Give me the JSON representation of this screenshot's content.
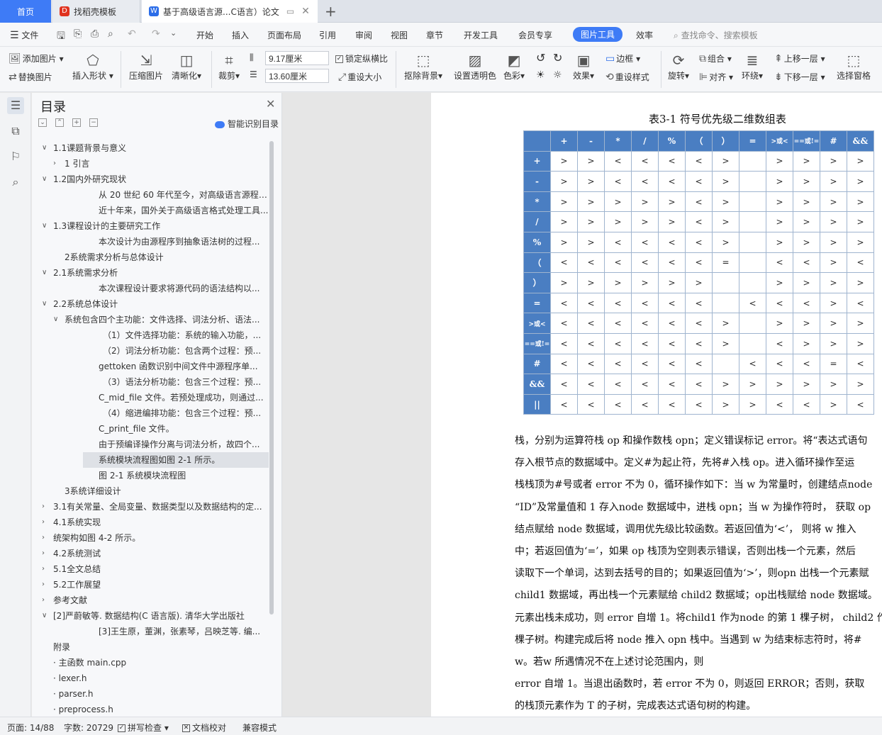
{
  "tabs": {
    "home": "首页",
    "t1": "找稻壳模板",
    "t2": "基于高级语言源...C语言）论文"
  },
  "menu": {
    "file": "文件",
    "items": [
      "开始",
      "插入",
      "页面布局",
      "引用",
      "审阅",
      "视图",
      "章节",
      "开发工具",
      "会员专享"
    ],
    "active": "图片工具",
    "efficiency": "效率",
    "search": "查找命令、搜索模板"
  },
  "ribbon": {
    "add_pic": "添加图片",
    "replace_pic": "替换图片",
    "insert_shape": "插入形状",
    "compress": "压缩图片",
    "sharpen": "清晰化",
    "crop": "裁剪",
    "width": "9.17厘米",
    "height": "13.60厘米",
    "lock_ratio": "锁定纵横比",
    "resize": "重设大小",
    "cutout": "抠除背景",
    "transparent": "设置透明色",
    "color": "色彩",
    "effect": "效果",
    "border": "边框",
    "reset_style": "重设样式",
    "rotate": "旋转",
    "group": "组合",
    "align": "对齐",
    "wrap": "环绕",
    "up": "上移一层",
    "down": "下移一层",
    "select_pane": "选择窗格"
  },
  "panel": {
    "title": "目录",
    "smart": "智能识别目录"
  },
  "toc": [
    {
      "text": "1.1课题背景与意义",
      "tw": "v"
    },
    {
      "text": "1 引言",
      "tw": ">"
    },
    {
      "text": "1.2国内外研究现状",
      "tw": "v"
    },
    {
      "text": "从 20 世纪 60 年代至今，对高级语言源程序...",
      "tw": ""
    },
    {
      "text": "近十年来，国外关于高级语言格式处理工具...",
      "tw": ""
    },
    {
      "text": "1.3课程设计的主要研究工作",
      "tw": "v"
    },
    {
      "text": "本次设计为由源程序到抽象语法树的过程...",
      "tw": ""
    },
    {
      "text": "2系统需求分析与总体设计",
      "tw": ""
    },
    {
      "text": "2.1系统需求分析",
      "tw": "v"
    },
    {
      "text": "本次课程设计要求将源代码的语法结构以...",
      "tw": ""
    },
    {
      "text": "2.2系统总体设计",
      "tw": "v"
    },
    {
      "text": "系统包含四个主功能：文件选择、词法分析、语法...",
      "tw": "v"
    },
    {
      "text": "（1）文件选择功能：系统的输入功能，...",
      "tw": ""
    },
    {
      "text": "（2）词法分析功能：包含两个过程：预...",
      "tw": ""
    },
    {
      "text": "gettoken 函数识别中间文件中源程序单...",
      "tw": ""
    },
    {
      "text": "（3）语法分析功能：包含三个过程：预...",
      "tw": ""
    },
    {
      "text": "C_mid_file 文件。若预处理成功，则通过...",
      "tw": ""
    },
    {
      "text": "（4）缩进编排功能：包含三个过程：预...",
      "tw": ""
    },
    {
      "text": "C_print_file 文件。",
      "tw": ""
    },
    {
      "text": "由于预编译操作分离与词法分析，故四个...",
      "tw": ""
    },
    {
      "text": "系统模块流程图如图 2-1 所示。",
      "tw": ""
    },
    {
      "text": "图 2-1  系统模块流程图",
      "tw": ""
    },
    {
      "text": "3系统详细设计",
      "tw": ""
    },
    {
      "text": "3.1有关常量、全局变量、数据类型以及数据结构的定...",
      "tw": ">"
    },
    {
      "text": "4.1系统实现",
      "tw": ">"
    },
    {
      "text": "统架构如图 4-2 所示。",
      "tw": ">"
    },
    {
      "text": "4.2系统测试",
      "tw": ">"
    },
    {
      "text": "5.1全文总结",
      "tw": ">"
    },
    {
      "text": "5.2工作展望",
      "tw": ">"
    },
    {
      "text": "参考文献",
      "tw": ">"
    },
    {
      "text": "[2]严蔚敏等. 数据结构(C 语言版). 清华大学出版社",
      "tw": "v"
    },
    {
      "text": "[3]王生原，董渊，张素琴，吕映芝等. 编...",
      "tw": ""
    },
    {
      "text": "附录",
      "tw": ""
    },
    {
      "text": "· 主函数 main.cpp",
      "tw": ""
    },
    {
      "text": "· lexer.h",
      "tw": ""
    },
    {
      "text": "· parser.h",
      "tw": ""
    },
    {
      "text": "· preprocess.h",
      "tw": ""
    }
  ],
  "doc": {
    "caption": "表3-1 符号优先级二维数组表",
    "table": {
      "header": [
        "",
        "+",
        "-",
        "*",
        "/",
        "%",
        "（",
        "）",
        "=",
        ">或<",
        "==或!=",
        "#",
        "&&"
      ],
      "rows": [
        [
          "+",
          ">",
          ">",
          "<",
          "<",
          "<",
          "<",
          ">",
          "",
          ">",
          ">",
          ">",
          ">"
        ],
        [
          "-",
          ">",
          ">",
          "<",
          "<",
          "<",
          "<",
          ">",
          "",
          ">",
          ">",
          ">",
          ">"
        ],
        [
          "*",
          ">",
          ">",
          ">",
          ">",
          ">",
          "<",
          ">",
          "",
          ">",
          ">",
          ">",
          ">"
        ],
        [
          "/",
          ">",
          ">",
          ">",
          ">",
          ">",
          "<",
          ">",
          "",
          ">",
          ">",
          ">",
          ">"
        ],
        [
          "%",
          ">",
          ">",
          "<",
          "<",
          "<",
          "<",
          ">",
          "",
          ">",
          ">",
          ">",
          ">"
        ],
        [
          "（",
          "<",
          "<",
          "<",
          "<",
          "<",
          "<",
          "=",
          "",
          "<",
          "<",
          ">",
          "<"
        ],
        [
          "）",
          ">",
          ">",
          ">",
          ">",
          ">",
          ">",
          "",
          "",
          ">",
          ">",
          ">",
          ">"
        ],
        [
          "=",
          "<",
          "<",
          "<",
          "<",
          "<",
          "<",
          "",
          "<",
          "<",
          "<",
          ">",
          "<"
        ],
        [
          ">或<",
          "<",
          "<",
          "<",
          "<",
          "<",
          "<",
          ">",
          "",
          ">",
          ">",
          ">",
          ">"
        ],
        [
          "==或!=",
          "<",
          "<",
          "<",
          "<",
          "<",
          "<",
          ">",
          "",
          "<",
          ">",
          ">",
          ">"
        ],
        [
          "#",
          "<",
          "<",
          "<",
          "<",
          "<",
          "<",
          "",
          "<",
          "<",
          "<",
          "=",
          "<"
        ],
        [
          "&&",
          "<",
          "<",
          "<",
          "<",
          "<",
          "<",
          ">",
          ">",
          ">",
          ">",
          ">",
          ">"
        ],
        [
          "||",
          "<",
          "<",
          "<",
          "<",
          "<",
          "<",
          ">",
          ">",
          "<",
          "<",
          ">",
          "<"
        ]
      ]
    },
    "paragraphs": [
      "栈，分别为运算符栈 op 和操作数栈 opn；定义错误标记 error。将“表达式语句",
      "存入根节点的数据域中。定义#为起止符，先将#入栈 op。进入循环操作至运",
      "栈栈顶为#号或者 error 不为 0，循环操作如下：当 w 为常量时，创建结点node",
      "“ID”及常量值和 1 存入node 数据域中，进栈 opn；当 w 为操作符时， 获取 op",
      "结点赋给 node 数据域，调用优先级比较函数。若返回值为‘<’， 则将 w 推入",
      "中；若返回值为‘=’，如果 op 栈顶为空则表示错误，否则出栈一个元素，然后",
      "读取下一个单词，达到去括号的目的；如果返回值为‘>’，则opn 出栈一个元素赋",
      "child1 数据域，再出栈一个元素赋给 child2 数据域；op出栈赋给 node 数据域。",
      "元素出栈未成功，则 error 自增 1。将child1 作为node 的第 1 棵子树， child2 作为",
      "棵子树。构建完成后将 node 推入 opn 栈中。当遇到 w 为结束标志符时，将#",
      "w。若w 所遇情况不在上述讨论范围内，则",
      "error 自增 1。当退出函数时，若 error 不为 0，则返回 ERROR；否则，获取",
      "的栈顶元素作为 T 的子树，完成表达式语句树的构建。"
    ]
  },
  "status": {
    "page": "页面: 14/88",
    "words": "字数: 20729",
    "spell": "拼写检查",
    "proof": "文档校对",
    "compat": "兼容模式"
  }
}
